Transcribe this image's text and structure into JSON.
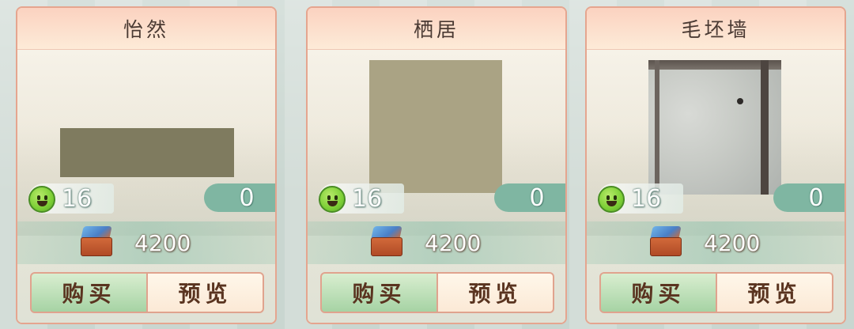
{
  "items": [
    {
      "title": "怡然",
      "comfort": "16",
      "owned": "0",
      "price": "4200",
      "buy_label": "购买",
      "preview_label": "预览",
      "swatch_color": "#7f7b5f"
    },
    {
      "title": "栖居",
      "comfort": "16",
      "owned": "0",
      "price": "4200",
      "buy_label": "购买",
      "preview_label": "预览",
      "swatch_color": "#aaa384"
    },
    {
      "title": "毛坯墙",
      "comfort": "16",
      "owned": "0",
      "price": "4200",
      "buy_label": "购买",
      "preview_label": "预览",
      "swatch_color": "#c3c6c2"
    }
  ],
  "icons": {
    "comfort": "smiley-face-icon",
    "price": "treasure-chest-icon"
  },
  "colors": {
    "card_border": "#e5a58f",
    "owned_pill": "#7fb6a2",
    "buy_button": "#a6d3a4",
    "preview_button": "#fbe9d6"
  }
}
